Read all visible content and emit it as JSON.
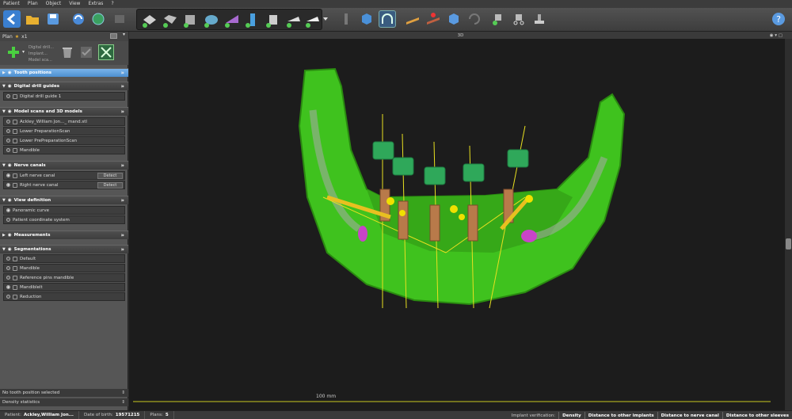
{
  "menu": [
    "Patient",
    "Plan",
    "Object",
    "View",
    "Extras",
    "?"
  ],
  "plan": {
    "label": "Plan",
    "count": "x1"
  },
  "plan_tools": [
    "Digital drill...",
    "Implant...",
    "Model sca..."
  ],
  "sections": {
    "tooth_positions": "Tooth positions",
    "digital_drill_guides": "Digital drill guides",
    "model_scans": "Model scans and 3D models",
    "nerve_canals": "Nerve canals",
    "view_definition": "View definition",
    "measurements": "Measurements",
    "segmentations": "Segmentations"
  },
  "drill_guides": [
    "Digital drill guide 1"
  ],
  "models": [
    "Ackley_William Jon..._ mand.stl",
    "Lower PreparationScan",
    "Lower PrePreparationScan",
    "Mandible"
  ],
  "nerves": [
    {
      "label": "Left nerve canal",
      "button": "Detect"
    },
    {
      "label": "Right nerve canal",
      "button": "Detect"
    }
  ],
  "view_def": [
    "Panoramic curve",
    "Patient coordinate system"
  ],
  "segs": [
    "Default",
    "Mandible",
    "Reference pins mandible",
    "Mandiblelt",
    "Reduction"
  ],
  "status_tooth": "No tooth position selected",
  "status_density": "Density statistics",
  "view_title": "3D",
  "scale_label": "100 mm",
  "bottom": {
    "patient_label": "Patient:",
    "patient_value": "Ackley,William Jon...",
    "dob_label": "Date of birth:",
    "dob_value": "19571215",
    "plans_label": "Plans:",
    "plans_value": "5",
    "verification_label": "Implant verification:",
    "buttons": [
      "Density",
      "Distance to other implants",
      "Distance to nerve canal",
      "Distance to other sleeves"
    ]
  },
  "colors": {
    "bone": "#3fc21e",
    "sleeve": "#2fa85a",
    "implant": "#b87a4a",
    "axis": "#e8e020",
    "nerve": "#c844c8",
    "accent": "#4d8fd0"
  }
}
